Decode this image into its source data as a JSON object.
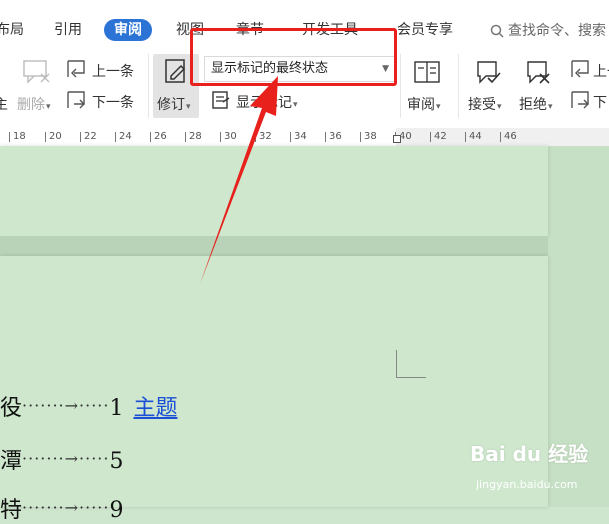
{
  "tabs": [
    {
      "label": "布局",
      "active": false
    },
    {
      "label": "引用",
      "active": false
    },
    {
      "label": "审阅",
      "active": true
    },
    {
      "label": "视图",
      "active": false
    },
    {
      "label": "章节",
      "active": false
    },
    {
      "label": "开发工具",
      "active": false
    },
    {
      "label": "会员专享",
      "active": false
    }
  ],
  "search": {
    "placeholder": "查找命令、搜索"
  },
  "ribbon": {
    "delete_label": "删除",
    "prev_label": "上一条",
    "next_label": "下一条",
    "revise_label": "修订",
    "markup_state_value": "显示标记的最终状态",
    "show_markup_label": "显示标记",
    "review_label": "审阅",
    "accept_label": "接受",
    "reject_label": "拒绝",
    "prev2_label": "上一",
    "next2_label": "下"
  },
  "ruler": {
    "ticks": [
      "18",
      "20",
      "22",
      "24",
      "26",
      "28",
      "30",
      "32",
      "34",
      "36",
      "38",
      "40",
      "42",
      "44",
      "46"
    ]
  },
  "document": {
    "toc": [
      {
        "text": "役",
        "page": "1",
        "link": "主题"
      },
      {
        "text": "潭",
        "page": "5",
        "link": ""
      },
      {
        "text": "特",
        "page": "9",
        "link": ""
      }
    ],
    "leader": "·······→·····"
  },
  "watermark": {
    "brand": "Bai du 经验",
    "url": "jingyan.baidu.com"
  },
  "colors": {
    "accent": "#2b74d6",
    "highlight": "#e8211c",
    "page_bg": "#cee7cd",
    "link": "#1a4fd6"
  }
}
